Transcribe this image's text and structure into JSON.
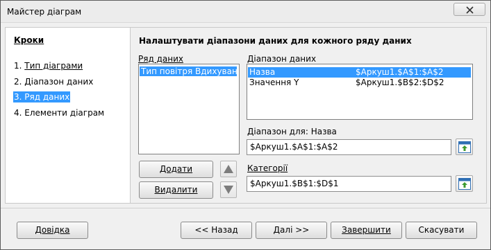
{
  "window": {
    "title": "Майстер діаграм"
  },
  "sidebar": {
    "title": "Кроки",
    "steps": [
      {
        "num": "1. ",
        "label": "Тип діаграми"
      },
      {
        "num": "2. ",
        "label": "Діапазон даних"
      },
      {
        "num": "3. ",
        "label": "Ряд даних"
      },
      {
        "num": "4. ",
        "label": "Елементи діаграм"
      }
    ],
    "active_step": 3
  },
  "main": {
    "heading": "Налаштувати діапазони даних для кожного ряду даних",
    "series_label": "Ряд даних",
    "series_items": [
      "Тип повітря  Вдихуване"
    ],
    "ranges_label": "Діапазон даних",
    "ranges": [
      {
        "role": "Назва",
        "range": "$Аркуш1.$A$1:$A$2"
      },
      {
        "role": "Значення Y",
        "range": "$Аркуш1.$B$2:$D$2"
      }
    ],
    "range_for_label": "Діапазон для: Назва",
    "range_for_value": "$Аркуш1.$A$1:$A$2",
    "categories_label": "Категорії",
    "categories_value": "$Аркуш1.$B$1:$D$1",
    "add_button": "Додати",
    "remove_button": "Видалити"
  },
  "footer": {
    "help": "Довідка",
    "back": "<< Назад",
    "next": "Далі >>",
    "finish": "Завершити",
    "cancel": "Скасувати"
  },
  "icons": {
    "close": "close-icon",
    "shrink": "shrink-range-icon",
    "up": "arrow-up-icon",
    "down": "arrow-down-icon"
  },
  "colors": {
    "selection": "#3399ff",
    "shrink_icon_green": "#3c9a2f",
    "shrink_icon_blue": "#2f6fb5"
  }
}
